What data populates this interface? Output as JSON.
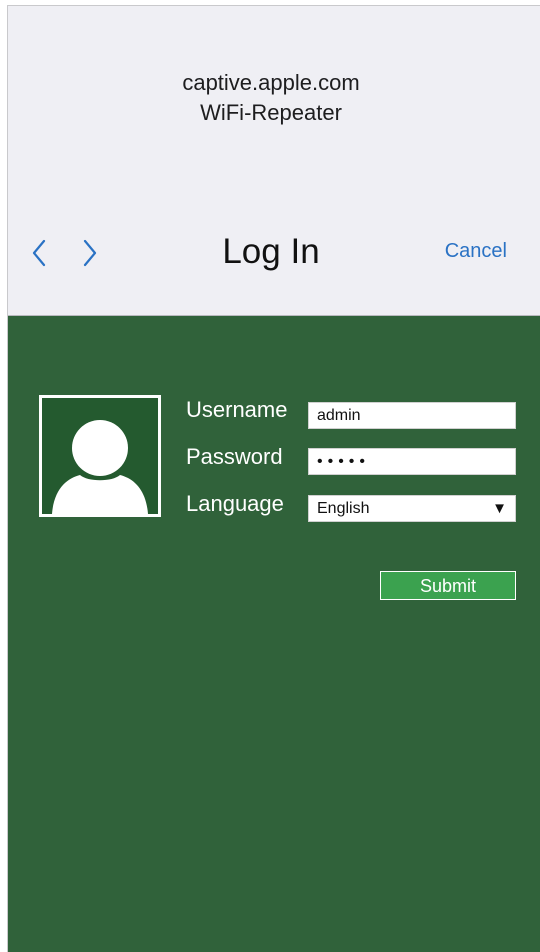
{
  "header": {
    "domain": "captive.apple.com",
    "network_name": "WiFi-Repeater",
    "title": "Log In",
    "cancel_label": "Cancel",
    "back_icon": "chevron-left-icon",
    "forward_icon": "chevron-right-icon"
  },
  "form": {
    "username_label": "Username",
    "username_value": "admin",
    "password_label": "Password",
    "password_value": "•••••",
    "language_label": "Language",
    "language_value": "English",
    "language_caret": "▼",
    "submit_label": "Submit",
    "avatar_icon": "user-silhouette-icon"
  },
  "colors": {
    "header_bg": "#efeff4",
    "content_bg": "#30623a",
    "accent_link": "#2a72c4",
    "submit_bg": "#3ba24f"
  }
}
